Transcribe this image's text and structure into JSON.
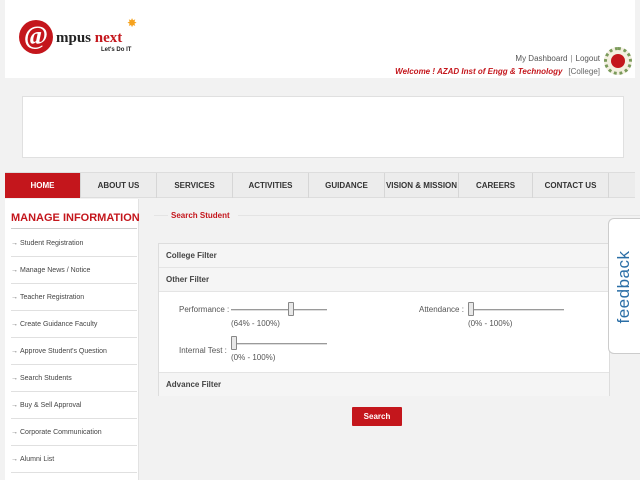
{
  "header": {
    "logo_name_pre": "mpus ",
    "logo_name_x": "next",
    "logo_tagline": "Let's Do IT",
    "links": {
      "dashboard": "My Dashboard",
      "sep": "|",
      "logout": "Logout"
    },
    "welcome": "Welcome ! AZAD Inst of Engg & Technology",
    "college_tag": "[College]"
  },
  "nav": {
    "items": [
      "HOME",
      "ABOUT US",
      "SERVICES",
      "ACTIVITIES",
      "GUIDANCE",
      "VISION & MISSION",
      "CAREERS",
      "CONTACT US"
    ],
    "active": "HOME"
  },
  "sidebar": {
    "title": "MANAGE INFORMATION",
    "arrow": "→",
    "items": [
      "Student Registration",
      "Manage News / Notice",
      "Teacher Registration",
      "Create Guidance Faculty",
      "Approve Student's Question",
      "Search Students",
      "Buy & Sell Approval",
      "Corporate Communication",
      "Alumni List"
    ]
  },
  "main": {
    "title": "Search Student",
    "college_filter": "College Filter",
    "other_filter": "Other Filter",
    "advance_filter": "Advance Filter",
    "performance": {
      "label": "Performance :",
      "range": "(64% - 100%)",
      "min": 64,
      "max": 100
    },
    "attendance": {
      "label": "Attendance :",
      "range": "(0% - 100%)",
      "min": 0,
      "max": 100
    },
    "internal_test": {
      "label": "Internal Test :",
      "range": "(0% - 100%)",
      "min": 0,
      "max": 100
    },
    "search_button": "Search"
  },
  "feedback": {
    "label": "feedback"
  },
  "colors": {
    "accent": "#c4161c",
    "feedback": "#2a6ea6"
  }
}
